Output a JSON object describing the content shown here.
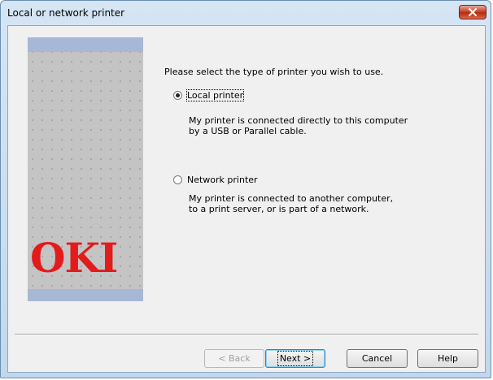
{
  "window": {
    "title": "Local or network printer"
  },
  "branding": {
    "logo_text": "OKI",
    "logo_color": "#e21b1b"
  },
  "prompt": "Please select the type of printer you wish to use.",
  "options": {
    "local": {
      "label": "Local printer",
      "selected": true,
      "desc_line1": "My printer is connected directly to this computer",
      "desc_line2": "by a USB or Parallel cable."
    },
    "network": {
      "label": "Network printer",
      "selected": false,
      "desc_line1": "My printer is connected to another computer,",
      "desc_line2": "to a print server, or is part of a network."
    }
  },
  "buttons": {
    "back": "< Back",
    "next": "Next >",
    "cancel": "Cancel",
    "help": "Help"
  },
  "colors": {
    "close_button": "#c9452b",
    "side_panel_band": "#a7b7d6"
  }
}
